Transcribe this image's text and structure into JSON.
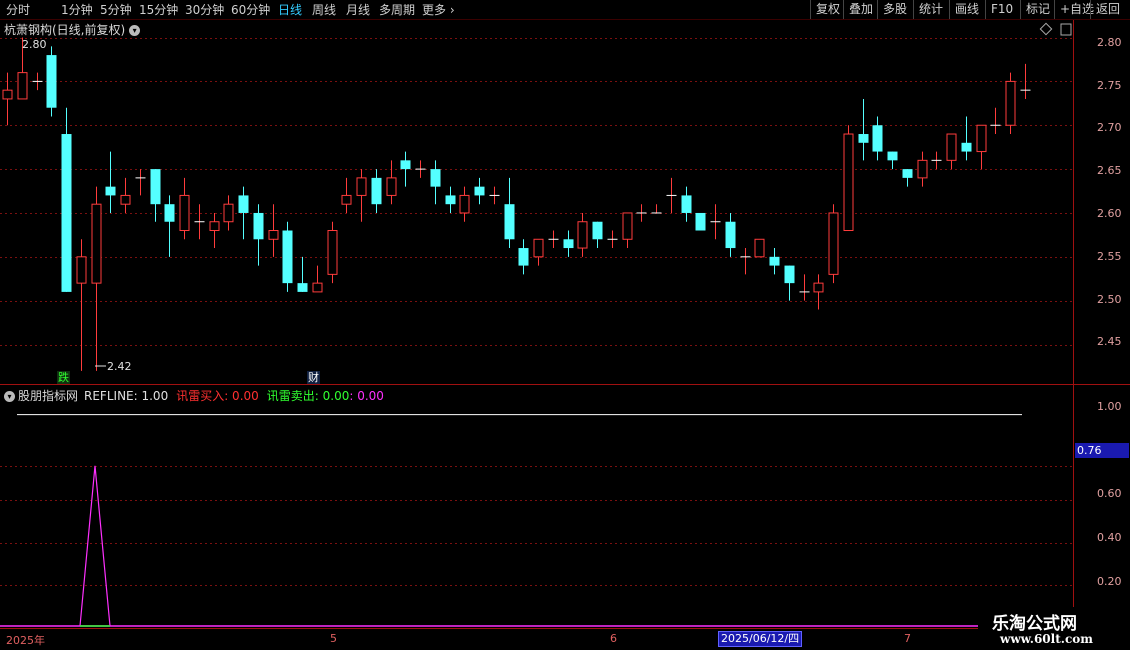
{
  "toolbar": {
    "periods": [
      "分时",
      "1分钟",
      "5分钟",
      "15分钟",
      "30分钟",
      "60分钟",
      "日线",
      "周线",
      "月线",
      "多周期"
    ],
    "more": "更多",
    "right": [
      "复权",
      "叠加",
      "多股",
      "统计",
      "画线",
      "F10",
      "标记",
      "+自选",
      "返回"
    ]
  },
  "main": {
    "title": "杭萧钢构(日线,前复权)",
    "high_label": "2.80",
    "low_label": "2.42",
    "yaxis": [
      "2.80",
      "2.75",
      "2.70",
      "2.65",
      "2.60",
      "2.55",
      "2.50",
      "2.45"
    ],
    "tags": {
      "die": "跌",
      "cai": "财"
    }
  },
  "sub": {
    "name": "股朋指标网",
    "refline": "REFLINE: 1.00",
    "buy": "讯雷买入: 0.00",
    "sell": "讯雷卖出: 0.00",
    "extra": ": 0.00",
    "yaxis": [
      "1.00",
      "0.60",
      "0.40",
      "0.20"
    ],
    "current": "0.76"
  },
  "dates": {
    "year": "2025年",
    "m5": "5",
    "m6": "6",
    "m7": "7",
    "selected": "2025/06/12/四"
  },
  "watermark": {
    "line1": "乐淘公式网",
    "line2": "www.60lt.com"
  },
  "colors": {
    "up": "#ff3c3c",
    "down": "#54ffff",
    "grid": "#7a1010",
    "signal": "#ff30ff"
  },
  "chart_data": {
    "type": "candlestick",
    "ylim": [
      2.405,
      2.82
    ],
    "candles": [
      [
        2.73,
        2.74,
        2.7,
        2.76
      ],
      [
        2.73,
        2.76,
        2.73,
        2.8
      ],
      [
        2.75,
        2.75,
        2.74,
        2.76
      ],
      [
        2.78,
        2.72,
        2.71,
        2.79
      ],
      [
        2.69,
        2.51,
        2.51,
        2.72
      ],
      [
        2.52,
        2.55,
        2.42,
        2.57
      ],
      [
        2.52,
        2.61,
        2.42,
        2.63
      ],
      [
        2.63,
        2.62,
        2.6,
        2.67
      ],
      [
        2.61,
        2.62,
        2.6,
        2.64
      ],
      [
        2.64,
        2.64,
        2.62,
        2.65
      ],
      [
        2.65,
        2.61,
        2.59,
        2.65
      ],
      [
        2.61,
        2.59,
        2.55,
        2.62
      ],
      [
        2.58,
        2.62,
        2.57,
        2.64
      ],
      [
        2.59,
        2.59,
        2.57,
        2.61
      ],
      [
        2.58,
        2.59,
        2.56,
        2.6
      ],
      [
        2.59,
        2.61,
        2.58,
        2.62
      ],
      [
        2.62,
        2.6,
        2.57,
        2.63
      ],
      [
        2.6,
        2.57,
        2.54,
        2.61
      ],
      [
        2.57,
        2.58,
        2.55,
        2.61
      ],
      [
        2.58,
        2.52,
        2.51,
        2.59
      ],
      [
        2.52,
        2.51,
        2.51,
        2.55
      ],
      [
        2.51,
        2.52,
        2.51,
        2.54
      ],
      [
        2.53,
        2.58,
        2.52,
        2.59
      ],
      [
        2.61,
        2.62,
        2.6,
        2.64
      ],
      [
        2.62,
        2.64,
        2.59,
        2.65
      ],
      [
        2.64,
        2.61,
        2.6,
        2.65
      ],
      [
        2.62,
        2.64,
        2.61,
        2.66
      ],
      [
        2.66,
        2.65,
        2.63,
        2.67
      ],
      [
        2.65,
        2.65,
        2.64,
        2.66
      ],
      [
        2.65,
        2.63,
        2.61,
        2.66
      ],
      [
        2.62,
        2.61,
        2.6,
        2.63
      ],
      [
        2.6,
        2.62,
        2.59,
        2.63
      ],
      [
        2.63,
        2.62,
        2.61,
        2.64
      ],
      [
        2.62,
        2.62,
        2.61,
        2.63
      ],
      [
        2.61,
        2.57,
        2.56,
        2.64
      ],
      [
        2.56,
        2.54,
        2.53,
        2.57
      ],
      [
        2.55,
        2.57,
        2.54,
        2.57
      ],
      [
        2.57,
        2.57,
        2.56,
        2.58
      ],
      [
        2.57,
        2.56,
        2.55,
        2.58
      ],
      [
        2.56,
        2.59,
        2.55,
        2.6
      ],
      [
        2.59,
        2.57,
        2.56,
        2.59
      ],
      [
        2.57,
        2.57,
        2.56,
        2.58
      ],
      [
        2.57,
        2.6,
        2.56,
        2.6
      ],
      [
        2.6,
        2.6,
        2.59,
        2.61
      ],
      [
        2.6,
        2.6,
        2.6,
        2.61
      ],
      [
        2.62,
        2.62,
        2.6,
        2.64
      ],
      [
        2.62,
        2.6,
        2.59,
        2.63
      ],
      [
        2.6,
        2.58,
        2.58,
        2.6
      ],
      [
        2.59,
        2.59,
        2.57,
        2.61
      ],
      [
        2.59,
        2.56,
        2.55,
        2.6
      ],
      [
        2.55,
        2.55,
        2.53,
        2.56
      ],
      [
        2.55,
        2.57,
        2.55,
        2.57
      ],
      [
        2.55,
        2.54,
        2.53,
        2.56
      ],
      [
        2.54,
        2.52,
        2.5,
        2.54
      ],
      [
        2.51,
        2.51,
        2.5,
        2.53
      ],
      [
        2.51,
        2.52,
        2.49,
        2.53
      ],
      [
        2.53,
        2.6,
        2.52,
        2.61
      ],
      [
        2.58,
        2.69,
        2.58,
        2.7
      ],
      [
        2.69,
        2.68,
        2.66,
        2.73
      ],
      [
        2.7,
        2.67,
        2.66,
        2.71
      ],
      [
        2.67,
        2.66,
        2.65,
        2.67
      ],
      [
        2.65,
        2.64,
        2.63,
        2.65
      ],
      [
        2.64,
        2.66,
        2.63,
        2.67
      ],
      [
        2.66,
        2.66,
        2.65,
        2.67
      ],
      [
        2.66,
        2.69,
        2.65,
        2.69
      ],
      [
        2.68,
        2.67,
        2.66,
        2.71
      ],
      [
        2.67,
        2.7,
        2.65,
        2.7
      ],
      [
        2.7,
        2.7,
        2.69,
        2.72
      ],
      [
        2.7,
        2.75,
        2.69,
        2.76
      ],
      [
        2.74,
        2.74,
        2.73,
        2.77
      ]
    ],
    "indicator": {
      "refline": 1.0,
      "ylim": [
        0.0,
        1.05
      ],
      "peak_index": 6,
      "peak_value": 0.76
    }
  }
}
